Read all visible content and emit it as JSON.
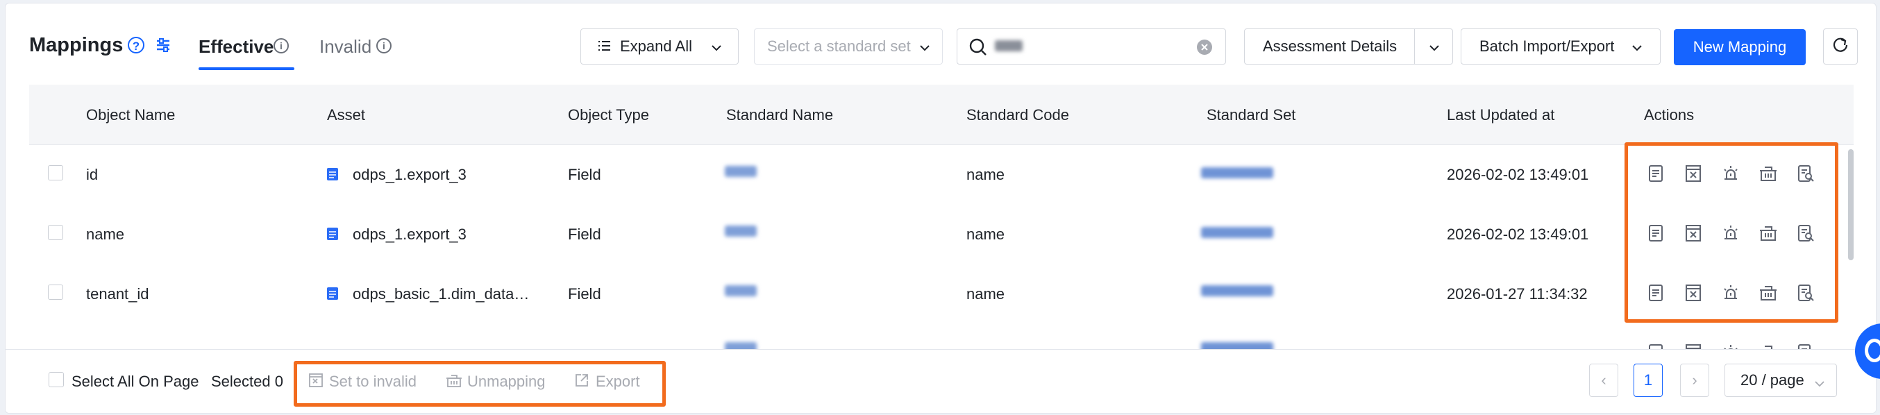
{
  "header": {
    "title": "Mappings",
    "tabs": [
      {
        "label": "Effective",
        "active": true
      },
      {
        "label": "Invalid",
        "active": false
      }
    ],
    "expand_all": "Expand All",
    "standard_set_placeholder": "Select a standard set",
    "search_value": "",
    "assessment_details": "Assessment Details",
    "batch_import_export": "Batch Import/Export",
    "new_mapping": "New Mapping"
  },
  "table": {
    "columns": [
      "Object Name",
      "Asset",
      "Object Type",
      "Standard Name",
      "Standard Code",
      "Standard Set",
      "Last Updated at",
      "Actions"
    ],
    "rows": [
      {
        "object_name": "id",
        "asset": "odps_1.export_3",
        "object_type": "Field",
        "standard_code": "name",
        "last_updated": "2026-02-02 13:49:01"
      },
      {
        "object_name": "name",
        "asset": "odps_1.export_3",
        "object_type": "Field",
        "standard_code": "name",
        "last_updated": "2026-02-02 13:49:01"
      },
      {
        "object_name": "tenant_id",
        "asset": "odps_basic_1.dim_data…",
        "object_type": "Field",
        "standard_code": "name",
        "last_updated": "2026-01-27 11:34:32"
      }
    ]
  },
  "footer": {
    "select_all": "Select All On Page",
    "selected": "Selected 0",
    "set_invalid": "Set to invalid",
    "unmapping": "Unmapping",
    "export": "Export",
    "current_page": "1",
    "page_size": "20 / page"
  },
  "colors": {
    "accent": "#1664ff",
    "highlight": "#f26b1d"
  }
}
